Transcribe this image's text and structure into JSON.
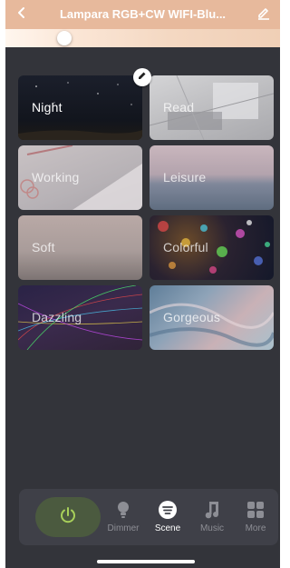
{
  "header": {
    "title": "Lampara RGB+CW WIFI-Blu...",
    "bg_color": "#e7b99c",
    "back_icon": "chevron-left-icon",
    "edit_icon": "pencil-icon"
  },
  "brightness_slider": {
    "value_fraction": 0.2
  },
  "scenes": [
    {
      "label": "Night",
      "active": true
    },
    {
      "label": "Read",
      "active": false
    },
    {
      "label": "Working",
      "active": false
    },
    {
      "label": "Leisure",
      "active": false
    },
    {
      "label": "Soft",
      "active": false
    },
    {
      "label": "Colorful",
      "active": false
    },
    {
      "label": "Dazzling",
      "active": false
    },
    {
      "label": "Gorgeous",
      "active": false
    }
  ],
  "tabs": [
    {
      "label": "Dimmer",
      "icon": "bulb-icon",
      "active": false
    },
    {
      "label": "Scene",
      "icon": "scene-icon",
      "active": true
    },
    {
      "label": "Music",
      "icon": "music-note-icon",
      "active": false
    },
    {
      "label": "More",
      "icon": "grid-icon",
      "active": false
    }
  ],
  "power": {
    "icon": "power-icon",
    "color": "#a8d05a"
  }
}
